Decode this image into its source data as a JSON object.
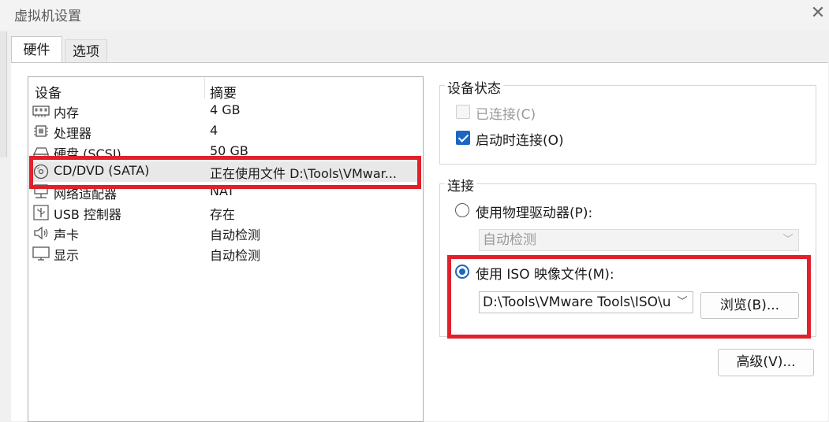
{
  "window": {
    "title": "虚拟机设置",
    "close_glyph": "✕"
  },
  "tabs": [
    {
      "label": "硬件"
    },
    {
      "label": "选项"
    }
  ],
  "device_list": {
    "columns": {
      "device": "设备",
      "summary": "摘要"
    },
    "rows": [
      {
        "name": "内存",
        "summary": "4 GB",
        "icon": "memory-icon"
      },
      {
        "name": "处理器",
        "summary": "4",
        "icon": "processor-icon"
      },
      {
        "name": "硬盘 (SCSI)",
        "summary": "50 GB",
        "icon": "hard-disk-icon"
      },
      {
        "name": "CD/DVD (SATA)",
        "summary": "正在使用文件 D:\\Tools\\VMwar...",
        "icon": "cd-dvd-icon",
        "selected": true
      },
      {
        "name": "网络适配器",
        "summary": "NAT",
        "icon": "network-adapter-icon"
      },
      {
        "name": "USB 控制器",
        "summary": "存在",
        "icon": "usb-icon"
      },
      {
        "name": "声卡",
        "summary": "自动检测",
        "icon": "speaker-icon"
      },
      {
        "name": "显示",
        "summary": "自动检测",
        "icon": "monitor-icon"
      }
    ]
  },
  "device_status": {
    "label": "设备状态",
    "connected": {
      "label": "已连接(C)",
      "checked": false,
      "enabled": false
    },
    "connect_at_power_on": {
      "label": "启动时连接(O)",
      "checked": true
    }
  },
  "connection": {
    "label": "连接",
    "physical_drive": {
      "label": "使用物理驱动器(P):",
      "selected": false,
      "value": "自动检测"
    },
    "iso_file": {
      "label": "使用 ISO 映像文件(M):",
      "selected": true,
      "value": "D:\\Tools\\VMware Tools\\ISO\\u",
      "browse_label": "浏览(B)..."
    }
  },
  "advanced_button": "高级(V)...",
  "colors": {
    "accent": "#1a66c2",
    "highlight": "#e0202a"
  }
}
